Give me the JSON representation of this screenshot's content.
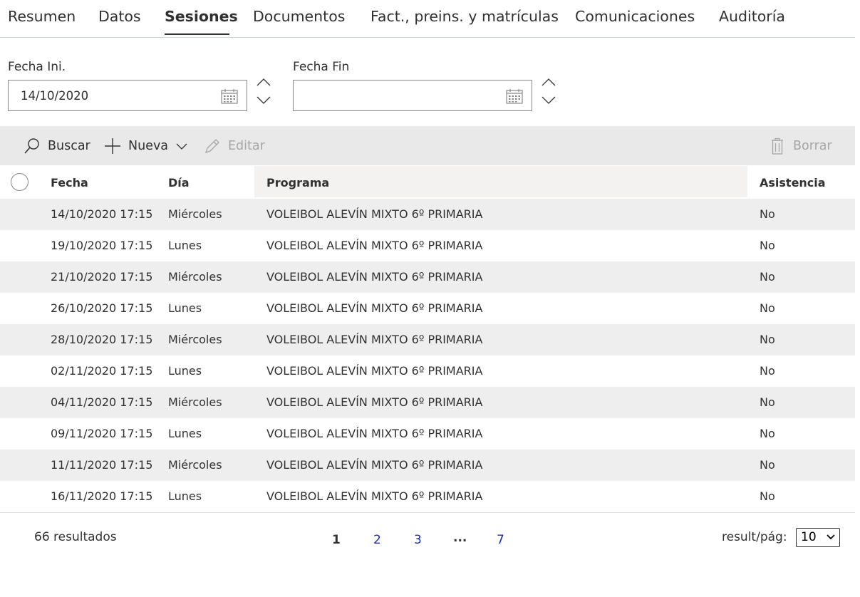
{
  "tabs": [
    {
      "label": "Resumen",
      "active": false
    },
    {
      "label": "Datos",
      "active": false
    },
    {
      "label": "Sesiones",
      "active": true
    },
    {
      "label": "Documentos",
      "active": false
    },
    {
      "label": "Fact., preins. y matrículas",
      "active": false
    },
    {
      "label": "Comunicaciones",
      "active": false
    },
    {
      "label": "Auditoría",
      "active": false
    }
  ],
  "filters": {
    "start": {
      "label": "Fecha Ini.",
      "value": "14/10/2020"
    },
    "end": {
      "label": "Fecha Fin",
      "value": ""
    }
  },
  "toolbar": {
    "search_label": "Buscar",
    "new_label": "Nueva",
    "edit_label": "Editar",
    "delete_label": "Borrar"
  },
  "table": {
    "columns": [
      "Fecha",
      "Día",
      "Programa",
      "Asistencia"
    ],
    "rows": [
      {
        "fecha": "14/10/2020 17:15",
        "dia": "Miércoles",
        "programa": "VOLEIBOL ALEVÍN MIXTO 6º PRIMARIA",
        "asistencia": "No"
      },
      {
        "fecha": "19/10/2020 17:15",
        "dia": "Lunes",
        "programa": "VOLEIBOL ALEVÍN MIXTO 6º PRIMARIA",
        "asistencia": "No"
      },
      {
        "fecha": "21/10/2020 17:15",
        "dia": "Miércoles",
        "programa": "VOLEIBOL ALEVÍN MIXTO 6º PRIMARIA",
        "asistencia": "No"
      },
      {
        "fecha": "26/10/2020 17:15",
        "dia": "Lunes",
        "programa": "VOLEIBOL ALEVÍN MIXTO 6º PRIMARIA",
        "asistencia": "No"
      },
      {
        "fecha": "28/10/2020 17:15",
        "dia": "Miércoles",
        "programa": "VOLEIBOL ALEVÍN MIXTO 6º PRIMARIA",
        "asistencia": "No"
      },
      {
        "fecha": "02/11/2020 17:15",
        "dia": "Lunes",
        "programa": "VOLEIBOL ALEVÍN MIXTO 6º PRIMARIA",
        "asistencia": "No"
      },
      {
        "fecha": "04/11/2020 17:15",
        "dia": "Miércoles",
        "programa": "VOLEIBOL ALEVÍN MIXTO 6º PRIMARIA",
        "asistencia": "No"
      },
      {
        "fecha": "09/11/2020 17:15",
        "dia": "Lunes",
        "programa": "VOLEIBOL ALEVÍN MIXTO 6º PRIMARIA",
        "asistencia": "No"
      },
      {
        "fecha": "11/11/2020 17:15",
        "dia": "Miércoles",
        "programa": "VOLEIBOL ALEVÍN MIXTO 6º PRIMARIA",
        "asistencia": "No"
      },
      {
        "fecha": "16/11/2020 17:15",
        "dia": "Lunes",
        "programa": "VOLEIBOL ALEVÍN MIXTO 6º PRIMARIA",
        "asistencia": "No"
      }
    ]
  },
  "footer": {
    "results_text": "66 resultados",
    "pages": [
      "1",
      "2",
      "3",
      "...",
      "7"
    ],
    "current_page": "1",
    "per_page_label": "result/pág:",
    "per_page_value": "10"
  },
  "colors": {
    "link": "#1a2da8",
    "toolbar_bg": "#e9e9e9",
    "row_alt_bg": "#eeeeee",
    "text": "#323130",
    "disabled_text": "#a6a6a6"
  }
}
